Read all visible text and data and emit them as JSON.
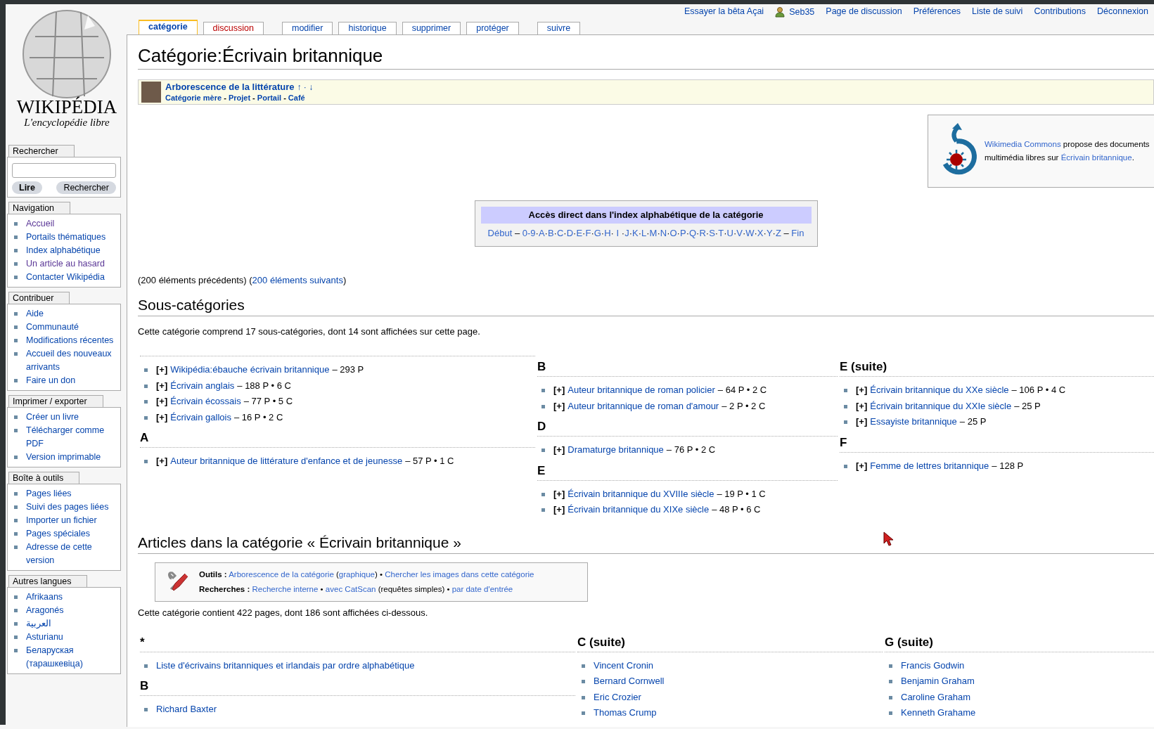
{
  "logo": {
    "wordmark": "WIKIPÉDIA",
    "tagline": "L'encyclopédie libre"
  },
  "personal_links": [
    {
      "text": "Essayer la bêta Açai",
      "kind": "link"
    },
    {
      "text": "Seb35",
      "kind": "user"
    },
    {
      "text": "Page de discussion",
      "kind": "link"
    },
    {
      "text": "Préférences",
      "kind": "link"
    },
    {
      "text": "Liste de suivi",
      "kind": "link"
    },
    {
      "text": "Contributions",
      "kind": "link"
    },
    {
      "text": "Déconnexion",
      "kind": "link"
    }
  ],
  "tabs": [
    {
      "label": "catégorie",
      "selected": true,
      "exists": true,
      "kind": "page"
    },
    {
      "label": "discussion",
      "selected": false,
      "exists": false,
      "kind": "page"
    },
    {
      "label": "modifier",
      "selected": false,
      "exists": true,
      "kind": "action"
    },
    {
      "label": "historique",
      "selected": false,
      "exists": true,
      "kind": "action"
    },
    {
      "label": "supprimer",
      "selected": false,
      "exists": true,
      "kind": "action"
    },
    {
      "label": "protéger",
      "selected": false,
      "exists": true,
      "kind": "action"
    },
    {
      "label": "suivre",
      "selected": false,
      "exists": true,
      "kind": "watch"
    }
  ],
  "sidebar": {
    "search": {
      "title": "Rechercher",
      "buttons": [
        "Lire",
        "Rechercher"
      ]
    },
    "portlets": [
      {
        "title": "Navigation",
        "items": [
          {
            "text": "Accueil",
            "visited": true
          },
          {
            "text": "Portails thématiques",
            "visited": false
          },
          {
            "text": "Index alphabétique",
            "visited": false
          },
          {
            "text": "Un article au hasard",
            "visited": true
          },
          {
            "text": "Contacter Wikipédia",
            "visited": false
          }
        ]
      },
      {
        "title": "Contribuer",
        "items": [
          {
            "text": "Aide",
            "visited": false
          },
          {
            "text": "Communauté",
            "visited": false
          },
          {
            "text": "Modifications récentes",
            "visited": false
          },
          {
            "text": "Accueil des nouveaux arrivants",
            "visited": false
          },
          {
            "text": "Faire un don",
            "visited": false
          }
        ]
      },
      {
        "title": "Imprimer / exporter",
        "items": [
          {
            "text": "Créer un livre",
            "visited": false
          },
          {
            "text": "Télécharger comme PDF",
            "visited": false
          },
          {
            "text": "Version imprimable",
            "visited": false
          }
        ]
      },
      {
        "title": "Boîte à outils",
        "items": [
          {
            "text": "Pages liées",
            "visited": false
          },
          {
            "text": "Suivi des pages liées",
            "visited": false
          },
          {
            "text": "Importer un fichier",
            "visited": false
          },
          {
            "text": "Pages spéciales",
            "visited": false
          },
          {
            "text": "Adresse de cette version",
            "visited": false
          }
        ]
      },
      {
        "title": "Autres langues",
        "items": [
          {
            "text": "Afrikaans",
            "visited": false
          },
          {
            "text": "Aragonés",
            "visited": false
          },
          {
            "text": "العربية",
            "visited": false
          },
          {
            "text": "Asturianu",
            "visited": false
          },
          {
            "text": "Беларуская (тарашкевіца)",
            "visited": false
          }
        ]
      }
    ]
  },
  "title": "Catégorie:Écrivain britannique",
  "banner": {
    "title": "Arborescence de la littérature",
    "arrows": "↑ · ↓",
    "parts": [
      {
        "text": "Catégorie mère",
        "link": true
      },
      {
        "text": " - "
      },
      {
        "text": "Projet",
        "link": true
      },
      {
        "text": " - "
      },
      {
        "text": "Portail",
        "link": true
      },
      {
        "text": " - "
      },
      {
        "text": "Café",
        "link": true
      }
    ]
  },
  "commons": {
    "parts": [
      {
        "text": "Wikimedia Commons",
        "link": true
      },
      {
        "text": " propose des documents multimédia libres sur "
      },
      {
        "text": "Écrivain britannique",
        "link": true
      },
      {
        "text": "."
      }
    ]
  },
  "index": {
    "title": "Accès direct dans l'index alphabétique de la catégorie",
    "parts": [
      {
        "text": "Début",
        "link": true
      },
      {
        "text": " – "
      },
      {
        "text": "0-9",
        "link": true
      },
      {
        "text": "·"
      },
      {
        "text": "A",
        "link": true
      },
      {
        "text": "·"
      },
      {
        "text": "B",
        "link": true
      },
      {
        "text": "·"
      },
      {
        "text": "C",
        "link": true
      },
      {
        "text": "·"
      },
      {
        "text": "D",
        "link": true
      },
      {
        "text": "·"
      },
      {
        "text": "E",
        "link": true
      },
      {
        "text": "·"
      },
      {
        "text": "F",
        "link": true
      },
      {
        "text": "·"
      },
      {
        "text": "G",
        "link": true
      },
      {
        "text": "·"
      },
      {
        "text": "H",
        "link": true
      },
      {
        "text": "· "
      },
      {
        "text": "I",
        "link": true
      },
      {
        "text": " ·"
      },
      {
        "text": "J",
        "link": true
      },
      {
        "text": "·"
      },
      {
        "text": "K",
        "link": true
      },
      {
        "text": "·"
      },
      {
        "text": "L",
        "link": true
      },
      {
        "text": "·"
      },
      {
        "text": "M",
        "link": true
      },
      {
        "text": "·"
      },
      {
        "text": "N",
        "link": true
      },
      {
        "text": "·"
      },
      {
        "text": "O",
        "link": true
      },
      {
        "text": "·"
      },
      {
        "text": "P",
        "link": true
      },
      {
        "text": "·"
      },
      {
        "text": "Q",
        "link": true
      },
      {
        "text": "·"
      },
      {
        "text": "R",
        "link": true
      },
      {
        "text": "·"
      },
      {
        "text": "S",
        "link": true
      },
      {
        "text": "·"
      },
      {
        "text": "T",
        "link": true
      },
      {
        "text": "·"
      },
      {
        "text": "U",
        "link": true
      },
      {
        "text": "·"
      },
      {
        "text": "V",
        "link": true
      },
      {
        "text": "·"
      },
      {
        "text": "W",
        "link": true
      },
      {
        "text": "·"
      },
      {
        "text": "X",
        "link": true
      },
      {
        "text": "·"
      },
      {
        "text": "Y",
        "link": true
      },
      {
        "text": "·"
      },
      {
        "text": "Z",
        "link": true
      },
      {
        "text": " – "
      },
      {
        "text": "Fin",
        "link": true
      }
    ]
  },
  "paging": {
    "parts": [
      {
        "text": "(200 éléments précédents) ("
      },
      {
        "text": "200 éléments suivants",
        "link": true
      },
      {
        "text": ")"
      }
    ]
  },
  "subcategories": {
    "heading": "Sous-catégories",
    "intro": "Cette catégorie comprend 17 sous-catégories, dont 14 sont affichées sur cette page.",
    "columns": [
      {
        "groups": [
          {
            "items": [
              {
                "expander": "[+]",
                "title": "Wikipédia:ébauche écrivain britannique",
                "count": "– 293 P"
              },
              {
                "expander": "[+]",
                "title": "Écrivain anglais",
                "count": "– 188 P • 6 C"
              },
              {
                "expander": "[+]",
                "title": "Écrivain écossais",
                "count": "– 77 P • 5 C"
              },
              {
                "expander": "[+]",
                "title": "Écrivain gallois",
                "count": "– 16 P • 2 C"
              }
            ]
          },
          {
            "heading": "A",
            "items": [
              {
                "expander": "[+]",
                "title": "Auteur britannique de littérature d'enfance et de jeunesse",
                "count": "– 57 P • 1 C"
              }
            ]
          }
        ]
      },
      {
        "groups": [
          {
            "heading": "B",
            "items": [
              {
                "expander": "[+]",
                "title": "Auteur britannique de roman policier",
                "count": "– 64 P • 2 C"
              },
              {
                "expander": "[+]",
                "title": "Auteur britannique de roman d'amour",
                "count": "– 2 P • 2 C"
              }
            ]
          },
          {
            "heading": "D",
            "items": [
              {
                "expander": "[+]",
                "title": "Dramaturge britannique",
                "count": "– 76 P • 2 C"
              }
            ]
          },
          {
            "heading": "E",
            "items": [
              {
                "expander": "[+]",
                "title": "Écrivain britannique du XVIIIe siècle",
                "count": "– 19 P • 1 C"
              },
              {
                "expander": "[+]",
                "title": "Écrivain britannique du XIXe siècle",
                "count": "– 48 P • 6 C"
              }
            ]
          }
        ]
      },
      {
        "groups": [
          {
            "heading": "E (suite)",
            "items": [
              {
                "expander": "[+]",
                "title": "Écrivain britannique du XXe siècle",
                "count": "– 106 P • 4 C"
              },
              {
                "expander": "[+]",
                "title": "Écrivain britannique du XXIe siècle",
                "count": "– 25 P"
              },
              {
                "expander": "[+]",
                "title": "Essayiste britannique",
                "count": "– 25 P"
              }
            ]
          },
          {
            "heading": "F",
            "items": [
              {
                "expander": "[+]",
                "title": "Femme de lettres britannique",
                "count": "– 128 P"
              }
            ]
          }
        ]
      }
    ]
  },
  "articles": {
    "heading": "Articles dans la catégorie « Écrivain britannique »",
    "tools": [
      {
        "label": "Outils :",
        "parts": [
          {
            "text": "Arborescence de la catégorie",
            "link": true
          },
          {
            "text": " ("
          },
          {
            "text": "graphique",
            "link": true
          },
          {
            "text": ") • "
          },
          {
            "text": "Chercher les images dans cette catégorie",
            "link": true
          }
        ]
      },
      {
        "label": "Recherches :",
        "parts": [
          {
            "text": "Recherche interne",
            "link": true
          },
          {
            "text": " • "
          },
          {
            "text": "avec CatScan",
            "link": true
          },
          {
            "text": " (requêtes simples) • "
          },
          {
            "text": "par date d'entrée",
            "link": true
          }
        ]
      }
    ],
    "intro": "Cette catégorie contient 422 pages, dont 186 sont affichées ci-dessous.",
    "columns": [
      {
        "groups": [
          {
            "heading": "*",
            "items": [
              {
                "title": "Liste d'écrivains britanniques et irlandais par ordre alphabétique"
              }
            ]
          },
          {
            "heading": "B",
            "items": [
              {
                "title": "Richard Baxter"
              }
            ]
          }
        ]
      },
      {
        "groups": [
          {
            "heading": "C (suite)",
            "items": [
              {
                "title": "Vincent Cronin"
              },
              {
                "title": "Bernard Cornwell"
              },
              {
                "title": "Eric Crozier"
              },
              {
                "title": "Thomas Crump"
              }
            ]
          }
        ]
      },
      {
        "groups": [
          {
            "heading": "G (suite)",
            "items": [
              {
                "title": "Francis Godwin"
              },
              {
                "title": "Benjamin Graham"
              },
              {
                "title": "Caroline Graham"
              },
              {
                "title": "Kenneth Grahame"
              }
            ]
          }
        ]
      }
    ]
  }
}
